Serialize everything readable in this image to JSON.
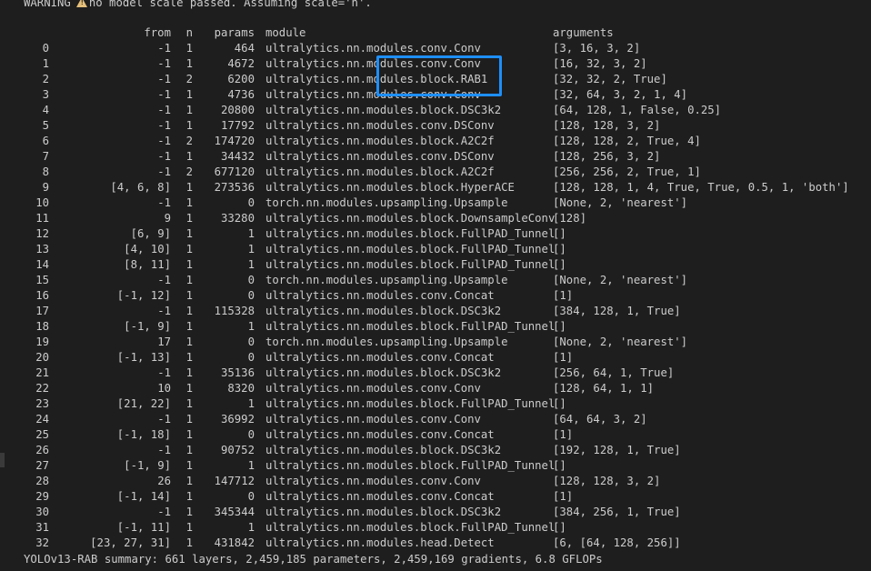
{
  "warning": {
    "prefix": "WARNING",
    "icon": "warning-icon",
    "message": "no model scale passed. Assuming scale='n'."
  },
  "header": {
    "from": "from",
    "n": "n",
    "params": "params",
    "module": "module",
    "arguments": "arguments"
  },
  "rows": [
    {
      "idx": "0",
      "from": "-1",
      "n": "1",
      "params": "464",
      "module": "ultralytics.nn.modules.conv.Conv",
      "args": "[3, 16, 3, 2]"
    },
    {
      "idx": "1",
      "from": "-1",
      "n": "1",
      "params": "4672",
      "module": "ultralytics.nn.modules.conv.Conv",
      "args": "[16, 32, 3, 2]"
    },
    {
      "idx": "2",
      "from": "-1",
      "n": "2",
      "params": "6200",
      "module": "ultralytics.nn.modules.block.RAB1",
      "args": "[32, 32, 2, True]"
    },
    {
      "idx": "3",
      "from": "-1",
      "n": "1",
      "params": "4736",
      "module": "ultralytics.nn.modules.conv.Conv",
      "args": "[32, 64, 3, 2, 1, 4]"
    },
    {
      "idx": "4",
      "from": "-1",
      "n": "1",
      "params": "20800",
      "module": "ultralytics.nn.modules.block.DSC3k2",
      "args": "[64, 128, 1, False, 0.25]"
    },
    {
      "idx": "5",
      "from": "-1",
      "n": "1",
      "params": "17792",
      "module": "ultralytics.nn.modules.conv.DSConv",
      "args": "[128, 128, 3, 2]"
    },
    {
      "idx": "6",
      "from": "-1",
      "n": "2",
      "params": "174720",
      "module": "ultralytics.nn.modules.block.A2C2f",
      "args": "[128, 128, 2, True, 4]"
    },
    {
      "idx": "7",
      "from": "-1",
      "n": "1",
      "params": "34432",
      "module": "ultralytics.nn.modules.conv.DSConv",
      "args": "[128, 256, 3, 2]"
    },
    {
      "idx": "8",
      "from": "-1",
      "n": "2",
      "params": "677120",
      "module": "ultralytics.nn.modules.block.A2C2f",
      "args": "[256, 256, 2, True, 1]"
    },
    {
      "idx": "9",
      "from": "[4, 6, 8]",
      "n": "1",
      "params": "273536",
      "module": "ultralytics.nn.modules.block.HyperACE",
      "args": "[128, 128, 1, 4, True, True, 0.5, 1, 'both']"
    },
    {
      "idx": "10",
      "from": "-1",
      "n": "1",
      "params": "0",
      "module": "torch.nn.modules.upsampling.Upsample",
      "args": "[None, 2, 'nearest']"
    },
    {
      "idx": "11",
      "from": "9",
      "n": "1",
      "params": "33280",
      "module": "ultralytics.nn.modules.block.DownsampleConv",
      "args": "[128]"
    },
    {
      "idx": "12",
      "from": "[6, 9]",
      "n": "1",
      "params": "1",
      "module": "ultralytics.nn.modules.block.FullPAD_Tunnel",
      "args": "[]"
    },
    {
      "idx": "13",
      "from": "[4, 10]",
      "n": "1",
      "params": "1",
      "module": "ultralytics.nn.modules.block.FullPAD_Tunnel",
      "args": "[]"
    },
    {
      "idx": "14",
      "from": "[8, 11]",
      "n": "1",
      "params": "1",
      "module": "ultralytics.nn.modules.block.FullPAD_Tunnel",
      "args": "[]"
    },
    {
      "idx": "15",
      "from": "-1",
      "n": "1",
      "params": "0",
      "module": "torch.nn.modules.upsampling.Upsample",
      "args": "[None, 2, 'nearest']"
    },
    {
      "idx": "16",
      "from": "[-1, 12]",
      "n": "1",
      "params": "0",
      "module": "ultralytics.nn.modules.conv.Concat",
      "args": "[1]"
    },
    {
      "idx": "17",
      "from": "-1",
      "n": "1",
      "params": "115328",
      "module": "ultralytics.nn.modules.block.DSC3k2",
      "args": "[384, 128, 1, True]"
    },
    {
      "idx": "18",
      "from": "[-1, 9]",
      "n": "1",
      "params": "1",
      "module": "ultralytics.nn.modules.block.FullPAD_Tunnel",
      "args": "[]"
    },
    {
      "idx": "19",
      "from": "17",
      "n": "1",
      "params": "0",
      "module": "torch.nn.modules.upsampling.Upsample",
      "args": "[None, 2, 'nearest']"
    },
    {
      "idx": "20",
      "from": "[-1, 13]",
      "n": "1",
      "params": "0",
      "module": "ultralytics.nn.modules.conv.Concat",
      "args": "[1]"
    },
    {
      "idx": "21",
      "from": "-1",
      "n": "1",
      "params": "35136",
      "module": "ultralytics.nn.modules.block.DSC3k2",
      "args": "[256, 64, 1, True]"
    },
    {
      "idx": "22",
      "from": "10",
      "n": "1",
      "params": "8320",
      "module": "ultralytics.nn.modules.conv.Conv",
      "args": "[128, 64, 1, 1]"
    },
    {
      "idx": "23",
      "from": "[21, 22]",
      "n": "1",
      "params": "1",
      "module": "ultralytics.nn.modules.block.FullPAD_Tunnel",
      "args": "[]"
    },
    {
      "idx": "24",
      "from": "-1",
      "n": "1",
      "params": "36992",
      "module": "ultralytics.nn.modules.conv.Conv",
      "args": "[64, 64, 3, 2]"
    },
    {
      "idx": "25",
      "from": "[-1, 18]",
      "n": "1",
      "params": "0",
      "module": "ultralytics.nn.modules.conv.Concat",
      "args": "[1]"
    },
    {
      "idx": "26",
      "from": "-1",
      "n": "1",
      "params": "90752",
      "module": "ultralytics.nn.modules.block.DSC3k2",
      "args": "[192, 128, 1, True]"
    },
    {
      "idx": "27",
      "from": "[-1, 9]",
      "n": "1",
      "params": "1",
      "module": "ultralytics.nn.modules.block.FullPAD_Tunnel",
      "args": "[]"
    },
    {
      "idx": "28",
      "from": "26",
      "n": "1",
      "params": "147712",
      "module": "ultralytics.nn.modules.conv.Conv",
      "args": "[128, 128, 3, 2]"
    },
    {
      "idx": "29",
      "from": "[-1, 14]",
      "n": "1",
      "params": "0",
      "module": "ultralytics.nn.modules.conv.Concat",
      "args": "[1]"
    },
    {
      "idx": "30",
      "from": "-1",
      "n": "1",
      "params": "345344",
      "module": "ultralytics.nn.modules.block.DSC3k2",
      "args": "[384, 256, 1, True]"
    },
    {
      "idx": "31",
      "from": "[-1, 11]",
      "n": "1",
      "params": "1",
      "module": "ultralytics.nn.modules.block.FullPAD_Tunnel",
      "args": "[]"
    },
    {
      "idx": "32",
      "from": "[23, 27, 31]",
      "n": "1",
      "params": "431842",
      "module": "ultralytics.nn.modules.head.Detect",
      "args": "[6, [64, 128, 256]]"
    }
  ],
  "summary": "YOLOv13-RAB summary: 661 layers, 2,459,185 parameters, 2,459,169 gradients, 6.8 GFLOPs",
  "colors": {
    "background": "#1e1e1e",
    "text": "#cccccc",
    "highlight": "#1e8fff",
    "warning": "#e5c07b"
  }
}
